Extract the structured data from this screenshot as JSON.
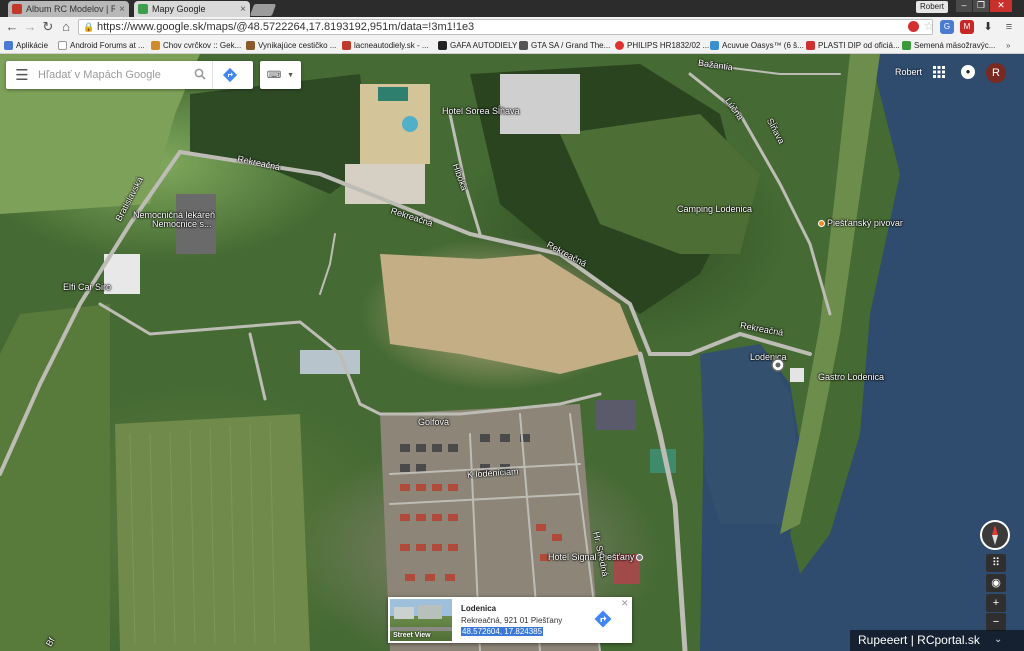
{
  "browser": {
    "tabs": [
      {
        "label": "Album RC Modelov | RC",
        "favicon_color": "#c0392b",
        "active": false
      },
      {
        "label": "Mapy Google",
        "favicon_color": "#3b9f4c",
        "active": true
      }
    ],
    "user_chip": "Robert",
    "address_url": "https://www.google.sk/maps/@48.5722264,17.8193192,951m/data=!3m1!1e3"
  },
  "bookmarks": [
    {
      "label": "Aplikácie",
      "icon_color": "#4a7bd0"
    },
    {
      "label": "Android Forums at ...",
      "icon_color": "#ffffff"
    },
    {
      "label": "Chov cvrčkov :: Gek...",
      "icon_color": "#d08a2a"
    },
    {
      "label": "Vynikajúce cestičko ...",
      "icon_color": "#8a5a2a"
    },
    {
      "label": "lacneautodiely.sk - ...",
      "icon_color": "#c0392b"
    },
    {
      "label": "GAFA AUTODIELY",
      "icon_color": "#222222"
    },
    {
      "label": "GTA SA / Grand The...",
      "icon_color": "#555555"
    },
    {
      "label": "PHILIPS HR1832/02 ...",
      "icon_color": "#e03030"
    },
    {
      "label": "Acuvue Oasys™ (6 š...",
      "icon_color": "#3a8fd0"
    },
    {
      "label": "PLASTI DIP od oficiá...",
      "icon_color": "#d03030"
    },
    {
      "label": "Semená mäsožravýc...",
      "icon_color": "#3a9a3a"
    }
  ],
  "search": {
    "placeholder": "Hľadať v Mapách Google"
  },
  "account": {
    "name": "Robert",
    "avatar_letter": "R"
  },
  "map_labels": {
    "roads": [
      "Rekreačná",
      "Rekreačná",
      "Rekreačná",
      "Rekreačná",
      "Golfová",
      "K lodeniciam",
      "Bratislavská",
      "Sĺňava",
      "Lúčna",
      "Hlboká",
      "Bažantia",
      "Hr. Stredná"
    ],
    "places": [
      "Hotel Sorea Sĺňava",
      "Nemocničná lekáreň",
      "Nemocnice s...",
      "Camping Lodenica",
      "Piešťanský pivovar",
      "Lodenica",
      "Gastro Lodenica",
      "Elfi Car Siro",
      "Hotel Signal Piešťany",
      "Bf"
    ]
  },
  "infocard": {
    "title": "Lodenica",
    "address": "Rekreačná, 921 01 Piešťany",
    "coordinates": "48.572604, 17.824385",
    "streetview_label": "Street View"
  },
  "watermark": "Rupeeert | RCportal.sk",
  "colors": {
    "water": "#2f4b6e",
    "accent": "#4285f4"
  }
}
